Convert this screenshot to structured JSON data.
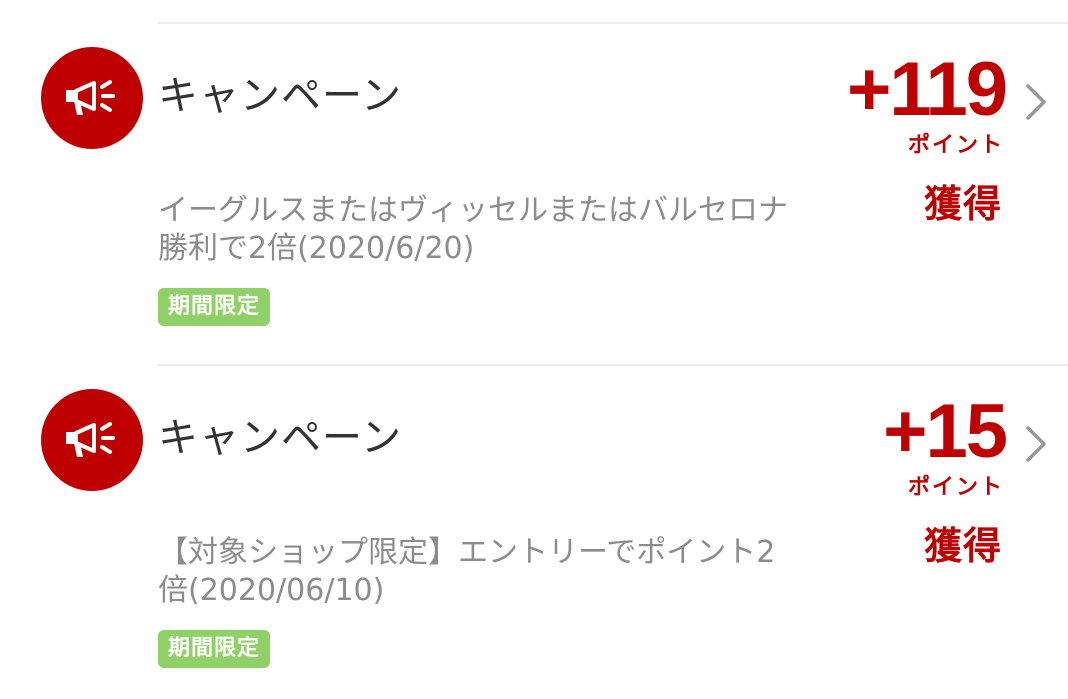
{
  "items": [
    {
      "category_label": "キャンペーン",
      "icon": "megaphone-icon",
      "points": "+119",
      "points_unit": "ポイント",
      "status": "獲得",
      "description": "イーグルスまたはヴィッセルまたはバルセロナ勝利で2倍(2020/6/20)",
      "badge": "期間限定"
    },
    {
      "category_label": "キャンペーン",
      "icon": "megaphone-icon",
      "points": "+15",
      "points_unit": "ポイント",
      "status": "獲得",
      "description": "【対象ショップ限定】エントリーでポイント2倍(2020/06/10)",
      "badge": "期間限定"
    }
  ],
  "colors": {
    "accent": "#bf0000",
    "badge": "#8fd067",
    "title_text": "#333333",
    "description_text": "#8c8c8c",
    "chevron": "#999999"
  }
}
